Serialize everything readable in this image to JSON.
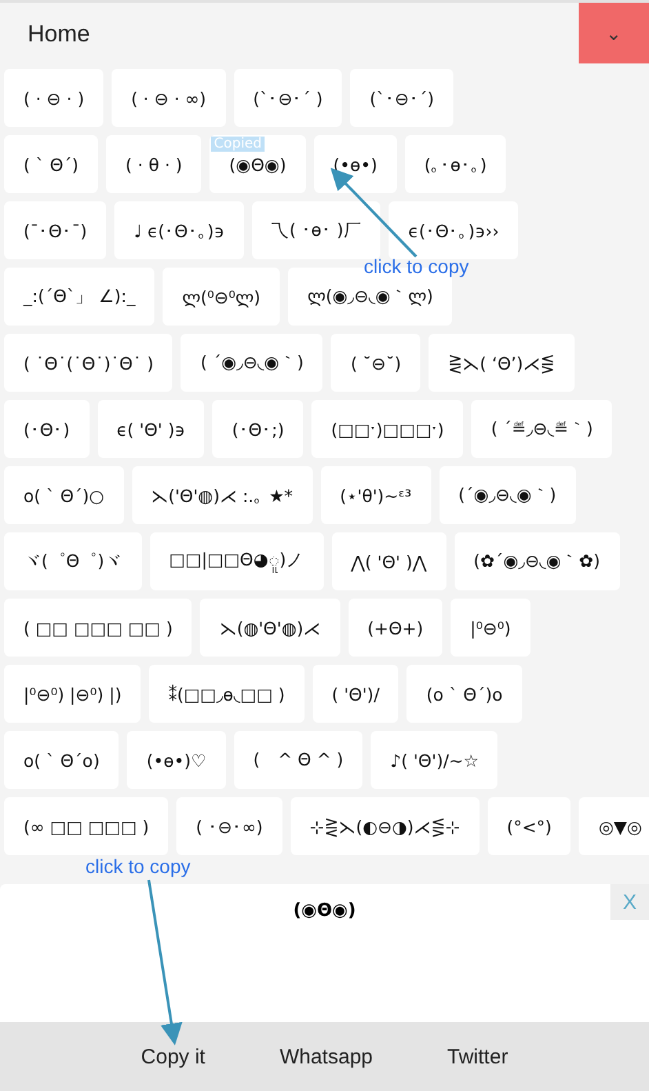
{
  "header": {
    "title": "Home",
    "menu_icon": "⌄"
  },
  "rows": [
    [
      "( · ⊖ · )",
      "( · ⊖ · ∞)",
      "(`･⊖･´ )",
      "(`･⊖･´)"
    ],
    [
      "( ` Θ´)",
      "( · θ · )",
      {
        "text": "(◉Θ◉)",
        "badge": "Copied"
      },
      "(•ѳ•)",
      "(｡･ѳ･｡)"
    ],
    [
      "(¯･Θ･¯)",
      "♩ ϵ(･Θ･｡)϶",
      "乁( ･ɵ･ )厂",
      "ϵ(･Θ･｡)϶››"
    ],
    [
      "_:(´Θ`」 ∠):_",
      "ლ(⁰⊖⁰ლ)",
      "ლ(◉◞⊖◟◉｀ლ)"
    ],
    [
      "( ˙Θ˙(˙Θ˙)˙Θ˙ )",
      "( ´◉◞⊖◟◉｀)",
      "( ˘⊖˘)",
      "⋛⋋( ‘Θ’)⋌⋚"
    ],
    [
      "(･Θ･)",
      "ϵ( 'Θ' )϶",
      "(･Θ･;)",
      "(□□ˑ)□□□ˑ)",
      "( ´≝◞⊖◟≝｀)"
    ],
    [
      "o( ` Θ´)○",
      "⋋('Θ'◍)⋌ :.｡ ★*",
      "(⋆'θ')~ᵋ³",
      "(´◉◞⊖◟◉｀)"
    ],
    [
      "ヾ(゜Θ゜)ヾ",
      "□□|□□Θ◕ူ)ノ",
      "⋀( 'Θ' )⋀",
      "(✿´◉◞⊖◟◉｀✿)"
    ],
    [
      "( □□ □□□ □□ )",
      "⋋(◍'Θ'◍)⋌",
      "(+Θ+)",
      "|⁰⊖⁰)"
    ],
    [
      "|⁰⊖⁰) |⊖⁰) |)",
      "⁑(□□◞ѳ◟□□ )",
      "( 'Θ')/",
      "(o ` Θ´)o"
    ],
    [
      "o( ` Θ´o)",
      "(•ѳ•)♡",
      "(　^ Θ ^ )",
      "♪( 'Θ')/~☆"
    ],
    [
      "(∞ □□ □□□ )",
      "( ･⊖･∞)",
      "⊹⋛⋋(◐⊖◑)⋌⋚⊹",
      "(°<°)",
      "◎▼◎"
    ]
  ],
  "preview": {
    "text": "(◉Θ◉)",
    "close": "X"
  },
  "actions": [
    "Copy it",
    "Whatsapp",
    "Twitter"
  ],
  "annotations": [
    "click to copy",
    "click to copy"
  ]
}
